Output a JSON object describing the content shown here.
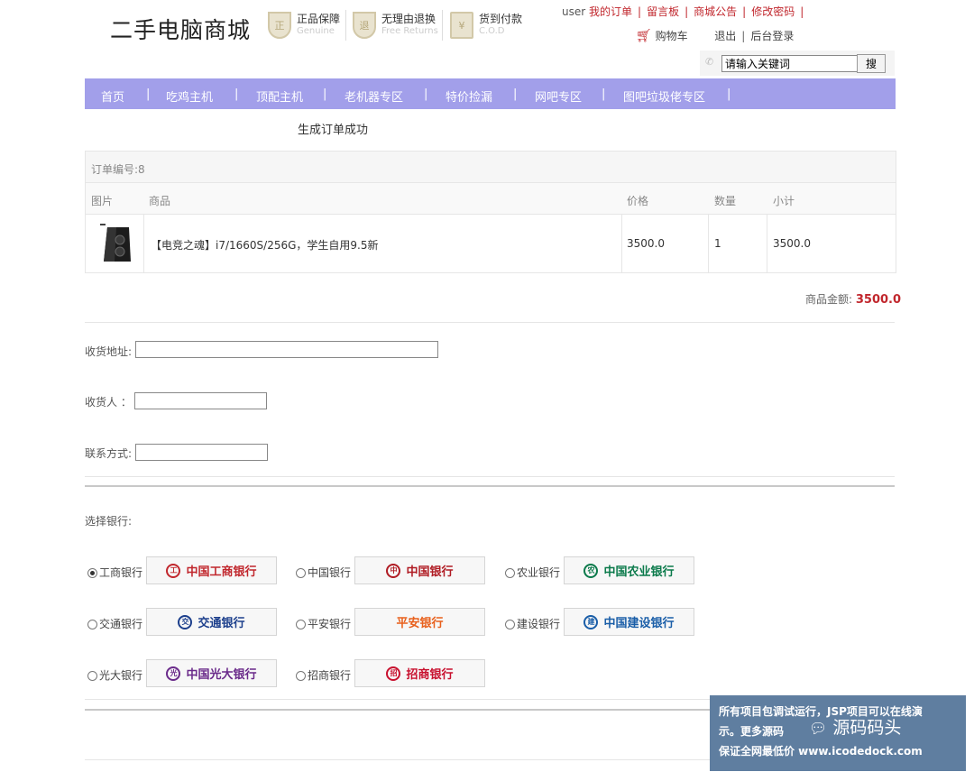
{
  "header": {
    "logo": "二手电脑商城",
    "badges": [
      {
        "icon": "genuine-shield-icon",
        "title": "正品保障",
        "sub": "Genuine"
      },
      {
        "icon": "return-shield-icon",
        "title": "无理由退换",
        "sub": "Free Returns"
      },
      {
        "icon": "cod-icon",
        "title": "货到付款",
        "sub": "C.O.D"
      }
    ],
    "user": "user",
    "links": [
      "我的订单",
      "留言板",
      "商城公告",
      "修改密码"
    ],
    "cart": "购物车",
    "logout": "退出",
    "admin": "后台登录"
  },
  "search": {
    "placeholder": "请输入关键词",
    "button": "搜"
  },
  "nav": [
    "首页",
    "吃鸡主机",
    "顶配主机",
    "老机器专区",
    "特价捡漏",
    "网吧专区",
    "图吧垃圾佬专区"
  ],
  "order": {
    "success": "生成订单成功",
    "number": "订单编号:8",
    "headers": [
      "图片",
      "商品",
      "价格",
      "数量",
      "小计"
    ],
    "item": {
      "name": "【电竞之魂】i7/1660S/256G，学生自用9.5新",
      "price": "3500.0",
      "qty": "1",
      "subtotal": "3500.0"
    },
    "total_label": "商品金额:",
    "total_value": "3500.0"
  },
  "form": {
    "address": "收货地址:",
    "receiver": "收货人 ：",
    "contact": "联系方式:"
  },
  "bank": {
    "title": "选择银行:",
    "options": [
      {
        "label": "工商银行",
        "logo": "中国工商银行",
        "selected": true,
        "color": "#c1272d"
      },
      {
        "label": "中国银行",
        "logo": "中国银行",
        "selected": false,
        "color": "#b01c24"
      },
      {
        "label": "农业银行",
        "logo": "中国农业银行",
        "selected": false,
        "color": "#0b7a4b"
      },
      {
        "label": "交通银行",
        "logo": "交通银行",
        "selected": false,
        "color": "#1c3f8c"
      },
      {
        "label": "平安银行",
        "logo": "平安银行",
        "selected": false,
        "color": "#e8601c"
      },
      {
        "label": "建设银行",
        "logo": "中国建设银行",
        "selected": false,
        "color": "#1a5ea8"
      },
      {
        "label": "光大银行",
        "logo": "中国光大银行",
        "selected": false,
        "color": "#6a2a8a"
      },
      {
        "label": "招商银行",
        "logo": "招商银行",
        "selected": false,
        "color": "#c8102e"
      }
    ]
  },
  "watermark": {
    "line1": "所有项目包调试运行，JSP项目可以在线演",
    "line2": "示。更多源码",
    "brand": "源码码头",
    "line3": "保证全网最低价 www.icodedock.com"
  }
}
